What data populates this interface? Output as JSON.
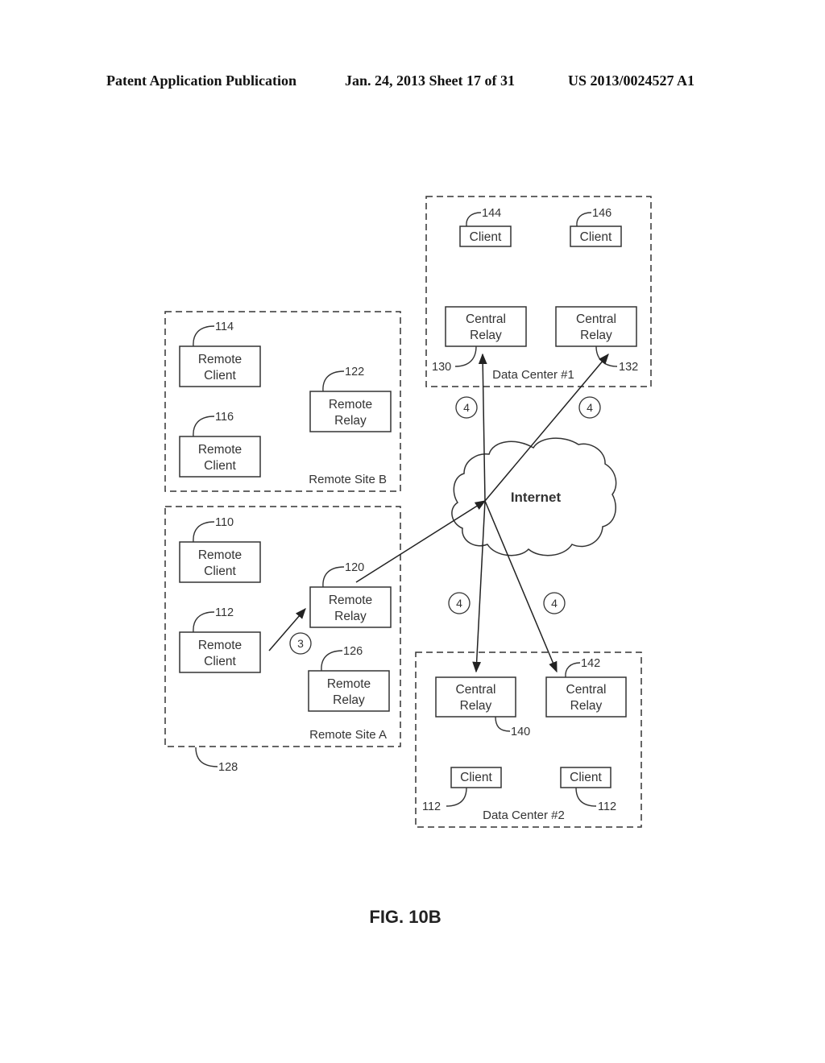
{
  "header": {
    "publication": "Patent Application Publication",
    "date_sheet": "Jan. 24, 2013  Sheet 17 of 31",
    "patent_number": "US 2013/0024527 A1"
  },
  "figure": {
    "caption": "FIG. 10B",
    "cloud_label": "Internet"
  },
  "regions": {
    "data_center_1": {
      "label": "Data Center #1"
    },
    "data_center_2": {
      "label": "Data Center #2"
    },
    "remote_site_a": {
      "label": "Remote Site A",
      "ref": "128"
    },
    "remote_site_b": {
      "label": "Remote Site B"
    }
  },
  "nodes": {
    "client_144": {
      "line1": "Client",
      "line2": "",
      "ref": "144"
    },
    "client_146": {
      "line1": "Client",
      "line2": "",
      "ref": "146"
    },
    "central_relay_130": {
      "line1": "Central",
      "line2": "Relay",
      "ref": "130"
    },
    "central_relay_132": {
      "line1": "Central",
      "line2": "Relay",
      "ref": "132"
    },
    "remote_client_114": {
      "line1": "Remote",
      "line2": "Client",
      "ref": "114"
    },
    "remote_client_116": {
      "line1": "Remote",
      "line2": "Client",
      "ref": "116"
    },
    "remote_relay_122": {
      "line1": "Remote",
      "line2": "Relay",
      "ref": "122"
    },
    "remote_client_110": {
      "line1": "Remote",
      "line2": "Client",
      "ref": "110"
    },
    "remote_client_112": {
      "line1": "Remote",
      "line2": "Client",
      "ref": "112"
    },
    "remote_relay_120": {
      "line1": "Remote",
      "line2": "Relay",
      "ref": "120"
    },
    "remote_relay_126": {
      "line1": "Remote",
      "line2": "Relay",
      "ref": "126"
    },
    "central_relay_140": {
      "line1": "Central",
      "line2": "Relay",
      "ref": "140"
    },
    "central_relay_142": {
      "line1": "Central",
      "line2": "Relay",
      "ref": "142"
    },
    "client_dc2_left": {
      "line1": "Client",
      "line2": "",
      "ref": "112"
    },
    "client_dc2_right": {
      "line1": "Client",
      "line2": "",
      "ref": "112"
    }
  },
  "steps": {
    "step3": "3",
    "step4_dc1_left": "4",
    "step4_dc1_right": "4",
    "step4_dc2_left": "4",
    "step4_dc2_right": "4"
  }
}
